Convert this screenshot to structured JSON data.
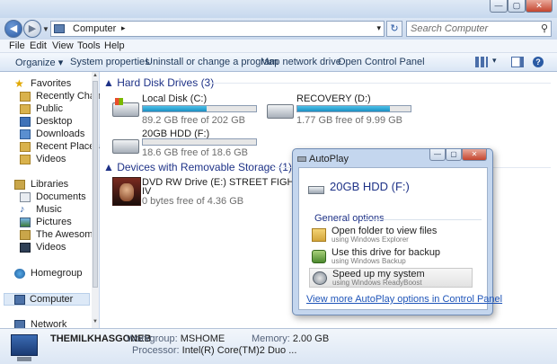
{
  "window": {
    "controls": [
      "minimize",
      "maximize",
      "close"
    ]
  },
  "address": {
    "crumb": "Computer",
    "search_placeholder": "Search Computer"
  },
  "menu": [
    "File",
    "Edit",
    "View",
    "Tools",
    "Help"
  ],
  "toolbar": [
    "Organize",
    "System properties",
    "Uninstall or change a program",
    "Map network drive",
    "Open Control Panel"
  ],
  "nav": {
    "favorites": "Favorites",
    "fav_items": [
      "Recently Change",
      "Public",
      "Desktop",
      "Downloads",
      "Recent Places",
      "Videos"
    ],
    "libraries": "Libraries",
    "lib_items": [
      "Documents",
      "Music",
      "Pictures",
      "The Awesome",
      "Videos"
    ],
    "homegroup": "Homegroup",
    "computer": "Computer",
    "network": "Network"
  },
  "groups": {
    "hdd": "Hard Disk Drives (3)",
    "removable": "Devices with Removable Storage (1)"
  },
  "drives": [
    {
      "name": "Local Disk (C:)",
      "free": "89.2 GB free of 202 GB",
      "used_fraction": 0.56
    },
    {
      "name": "RECOVERY (D:)",
      "free": "1.77 GB free of 9.99 GB",
      "used_fraction": 0.82
    },
    {
      "name": "20GB HDD (F:)",
      "free": "18.6 GB free of 18.6 GB",
      "used_fraction": 0.0
    }
  ],
  "dvd": {
    "name_line1": "DVD RW Drive (E:) STREET FIGHTER",
    "name_line2": "IV",
    "free": "0 bytes free of 4.36 GB"
  },
  "details": {
    "computer_name": "THEMILKHASGONEB",
    "workgroup_label": "Workgroup:",
    "workgroup": "MSHOME",
    "memory_label": "Memory:",
    "memory": "2.00 GB",
    "processor_label": "Processor:",
    "processor": "Intel(R) Core(TM)2 Duo ..."
  },
  "autoplay": {
    "title": "AutoPlay",
    "drive": "20GB HDD (F:)",
    "general": "General options",
    "options": [
      {
        "title": "Open folder to view files",
        "sub": "using Windows Explorer"
      },
      {
        "title": "Use this drive for backup",
        "sub": "using Windows Backup"
      },
      {
        "title": "Speed up my system",
        "sub": "using Windows ReadyBoost"
      }
    ],
    "link": "View more AutoPlay options in Control Panel"
  },
  "colors": {
    "accent": "#1e3287",
    "bar_fill": "#1c8fc3",
    "link": "#1f55b9"
  }
}
